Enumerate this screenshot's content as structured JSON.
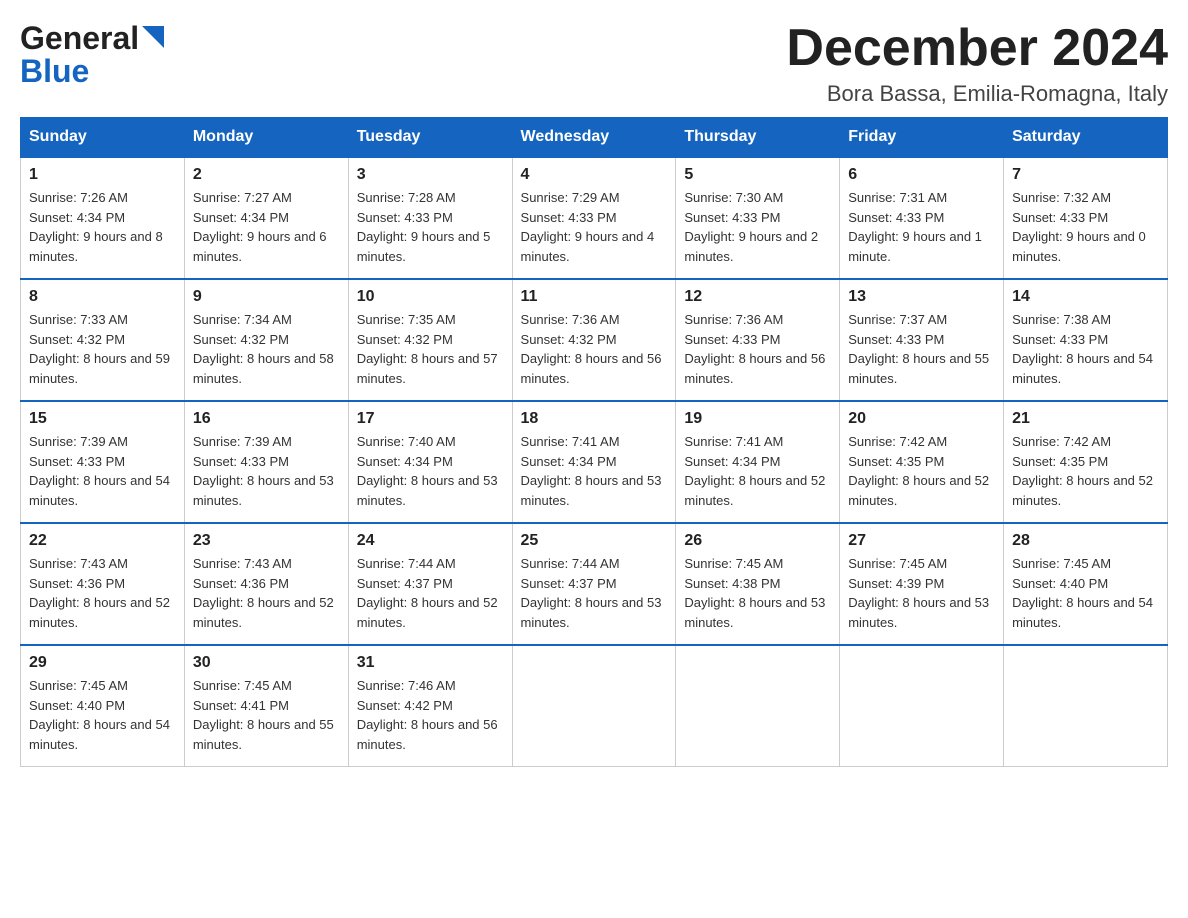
{
  "logo": {
    "general": "General",
    "blue": "Blue"
  },
  "header": {
    "month": "December 2024",
    "location": "Bora Bassa, Emilia-Romagna, Italy"
  },
  "weekdays": [
    "Sunday",
    "Monday",
    "Tuesday",
    "Wednesday",
    "Thursday",
    "Friday",
    "Saturday"
  ],
  "weeks": [
    [
      {
        "day": "1",
        "sunrise": "7:26 AM",
        "sunset": "4:34 PM",
        "daylight": "9 hours and 8 minutes."
      },
      {
        "day": "2",
        "sunrise": "7:27 AM",
        "sunset": "4:34 PM",
        "daylight": "9 hours and 6 minutes."
      },
      {
        "day": "3",
        "sunrise": "7:28 AM",
        "sunset": "4:33 PM",
        "daylight": "9 hours and 5 minutes."
      },
      {
        "day": "4",
        "sunrise": "7:29 AM",
        "sunset": "4:33 PM",
        "daylight": "9 hours and 4 minutes."
      },
      {
        "day": "5",
        "sunrise": "7:30 AM",
        "sunset": "4:33 PM",
        "daylight": "9 hours and 2 minutes."
      },
      {
        "day": "6",
        "sunrise": "7:31 AM",
        "sunset": "4:33 PM",
        "daylight": "9 hours and 1 minute."
      },
      {
        "day": "7",
        "sunrise": "7:32 AM",
        "sunset": "4:33 PM",
        "daylight": "9 hours and 0 minutes."
      }
    ],
    [
      {
        "day": "8",
        "sunrise": "7:33 AM",
        "sunset": "4:32 PM",
        "daylight": "8 hours and 59 minutes."
      },
      {
        "day": "9",
        "sunrise": "7:34 AM",
        "sunset": "4:32 PM",
        "daylight": "8 hours and 58 minutes."
      },
      {
        "day": "10",
        "sunrise": "7:35 AM",
        "sunset": "4:32 PM",
        "daylight": "8 hours and 57 minutes."
      },
      {
        "day": "11",
        "sunrise": "7:36 AM",
        "sunset": "4:32 PM",
        "daylight": "8 hours and 56 minutes."
      },
      {
        "day": "12",
        "sunrise": "7:36 AM",
        "sunset": "4:33 PM",
        "daylight": "8 hours and 56 minutes."
      },
      {
        "day": "13",
        "sunrise": "7:37 AM",
        "sunset": "4:33 PM",
        "daylight": "8 hours and 55 minutes."
      },
      {
        "day": "14",
        "sunrise": "7:38 AM",
        "sunset": "4:33 PM",
        "daylight": "8 hours and 54 minutes."
      }
    ],
    [
      {
        "day": "15",
        "sunrise": "7:39 AM",
        "sunset": "4:33 PM",
        "daylight": "8 hours and 54 minutes."
      },
      {
        "day": "16",
        "sunrise": "7:39 AM",
        "sunset": "4:33 PM",
        "daylight": "8 hours and 53 minutes."
      },
      {
        "day": "17",
        "sunrise": "7:40 AM",
        "sunset": "4:34 PM",
        "daylight": "8 hours and 53 minutes."
      },
      {
        "day": "18",
        "sunrise": "7:41 AM",
        "sunset": "4:34 PM",
        "daylight": "8 hours and 53 minutes."
      },
      {
        "day": "19",
        "sunrise": "7:41 AM",
        "sunset": "4:34 PM",
        "daylight": "8 hours and 52 minutes."
      },
      {
        "day": "20",
        "sunrise": "7:42 AM",
        "sunset": "4:35 PM",
        "daylight": "8 hours and 52 minutes."
      },
      {
        "day": "21",
        "sunrise": "7:42 AM",
        "sunset": "4:35 PM",
        "daylight": "8 hours and 52 minutes."
      }
    ],
    [
      {
        "day": "22",
        "sunrise": "7:43 AM",
        "sunset": "4:36 PM",
        "daylight": "8 hours and 52 minutes."
      },
      {
        "day": "23",
        "sunrise": "7:43 AM",
        "sunset": "4:36 PM",
        "daylight": "8 hours and 52 minutes."
      },
      {
        "day": "24",
        "sunrise": "7:44 AM",
        "sunset": "4:37 PM",
        "daylight": "8 hours and 52 minutes."
      },
      {
        "day": "25",
        "sunrise": "7:44 AM",
        "sunset": "4:37 PM",
        "daylight": "8 hours and 53 minutes."
      },
      {
        "day": "26",
        "sunrise": "7:45 AM",
        "sunset": "4:38 PM",
        "daylight": "8 hours and 53 minutes."
      },
      {
        "day": "27",
        "sunrise": "7:45 AM",
        "sunset": "4:39 PM",
        "daylight": "8 hours and 53 minutes."
      },
      {
        "day": "28",
        "sunrise": "7:45 AM",
        "sunset": "4:40 PM",
        "daylight": "8 hours and 54 minutes."
      }
    ],
    [
      {
        "day": "29",
        "sunrise": "7:45 AM",
        "sunset": "4:40 PM",
        "daylight": "8 hours and 54 minutes."
      },
      {
        "day": "30",
        "sunrise": "7:45 AM",
        "sunset": "4:41 PM",
        "daylight": "8 hours and 55 minutes."
      },
      {
        "day": "31",
        "sunrise": "7:46 AM",
        "sunset": "4:42 PM",
        "daylight": "8 hours and 56 minutes."
      },
      null,
      null,
      null,
      null
    ]
  ],
  "labels": {
    "sunrise": "Sunrise:",
    "sunset": "Sunset:",
    "daylight": "Daylight:"
  }
}
